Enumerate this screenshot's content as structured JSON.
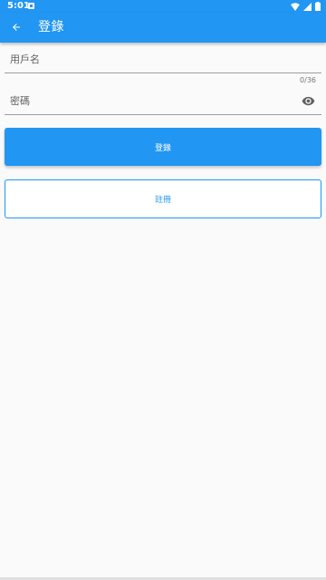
{
  "status_bar": {
    "time": "5:01"
  },
  "app_bar": {
    "title": "登錄",
    "back_icon": "arrow-back-icon"
  },
  "form": {
    "username": {
      "placeholder": "用戶名",
      "value": "",
      "counter": "0/36"
    },
    "password": {
      "placeholder": "密碼",
      "value": "",
      "toggle_icon": "eye-icon"
    }
  },
  "buttons": {
    "login_label": "登錄",
    "register_label": "註冊"
  },
  "colors": {
    "primary": "#2196f3",
    "background": "#fafafa"
  }
}
